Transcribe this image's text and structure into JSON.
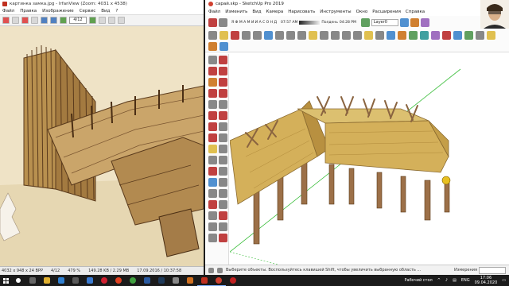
{
  "irfanview": {
    "title": "картинка замка.jpg - IrfanView (Zoom: 4031 x 4538)",
    "menu": [
      "Файл",
      "Правка",
      "Изображение",
      "Сервис",
      "Вид",
      "?"
    ],
    "page_field": "4/12",
    "status": {
      "dims": "4032 x 948 x 24 BPP",
      "page": "4/12",
      "zoom": "479 %",
      "size": "149.28 KB / 2.29 MB",
      "date": "17.09.2016 / 10:37:58"
    }
  },
  "sketchup": {
    "title": "сарай.skp - SketchUp Pro 2019",
    "menu": [
      "Файл",
      "Изменить",
      "Вид",
      "Камера",
      "Нарисовать",
      "Инструменты",
      "Окно",
      "Расширения",
      "Справка"
    ],
    "months": "Я Ф М А М И И А С О Н Д",
    "shadow_time_left": "07:57 AM",
    "shadow_mid": "Полдень",
    "shadow_time_right": "04:28 PM",
    "layer": "Layer0",
    "status_hint": "Выберите объекты. Воспользуйтесь клавишей Shift, чтобы увеличить выбранную область ...",
    "measurements_label": "Измерения"
  },
  "taskbar": {
    "desktop_label": "Рабочий стол",
    "lang": "ENG",
    "time": "17:06",
    "date": "09.04.2020"
  },
  "colors": {
    "thatch": "#d4b05a",
    "wood": "#9c7048",
    "axis_green": "#3fbf3f",
    "taskbar": "#1b1b1b"
  }
}
